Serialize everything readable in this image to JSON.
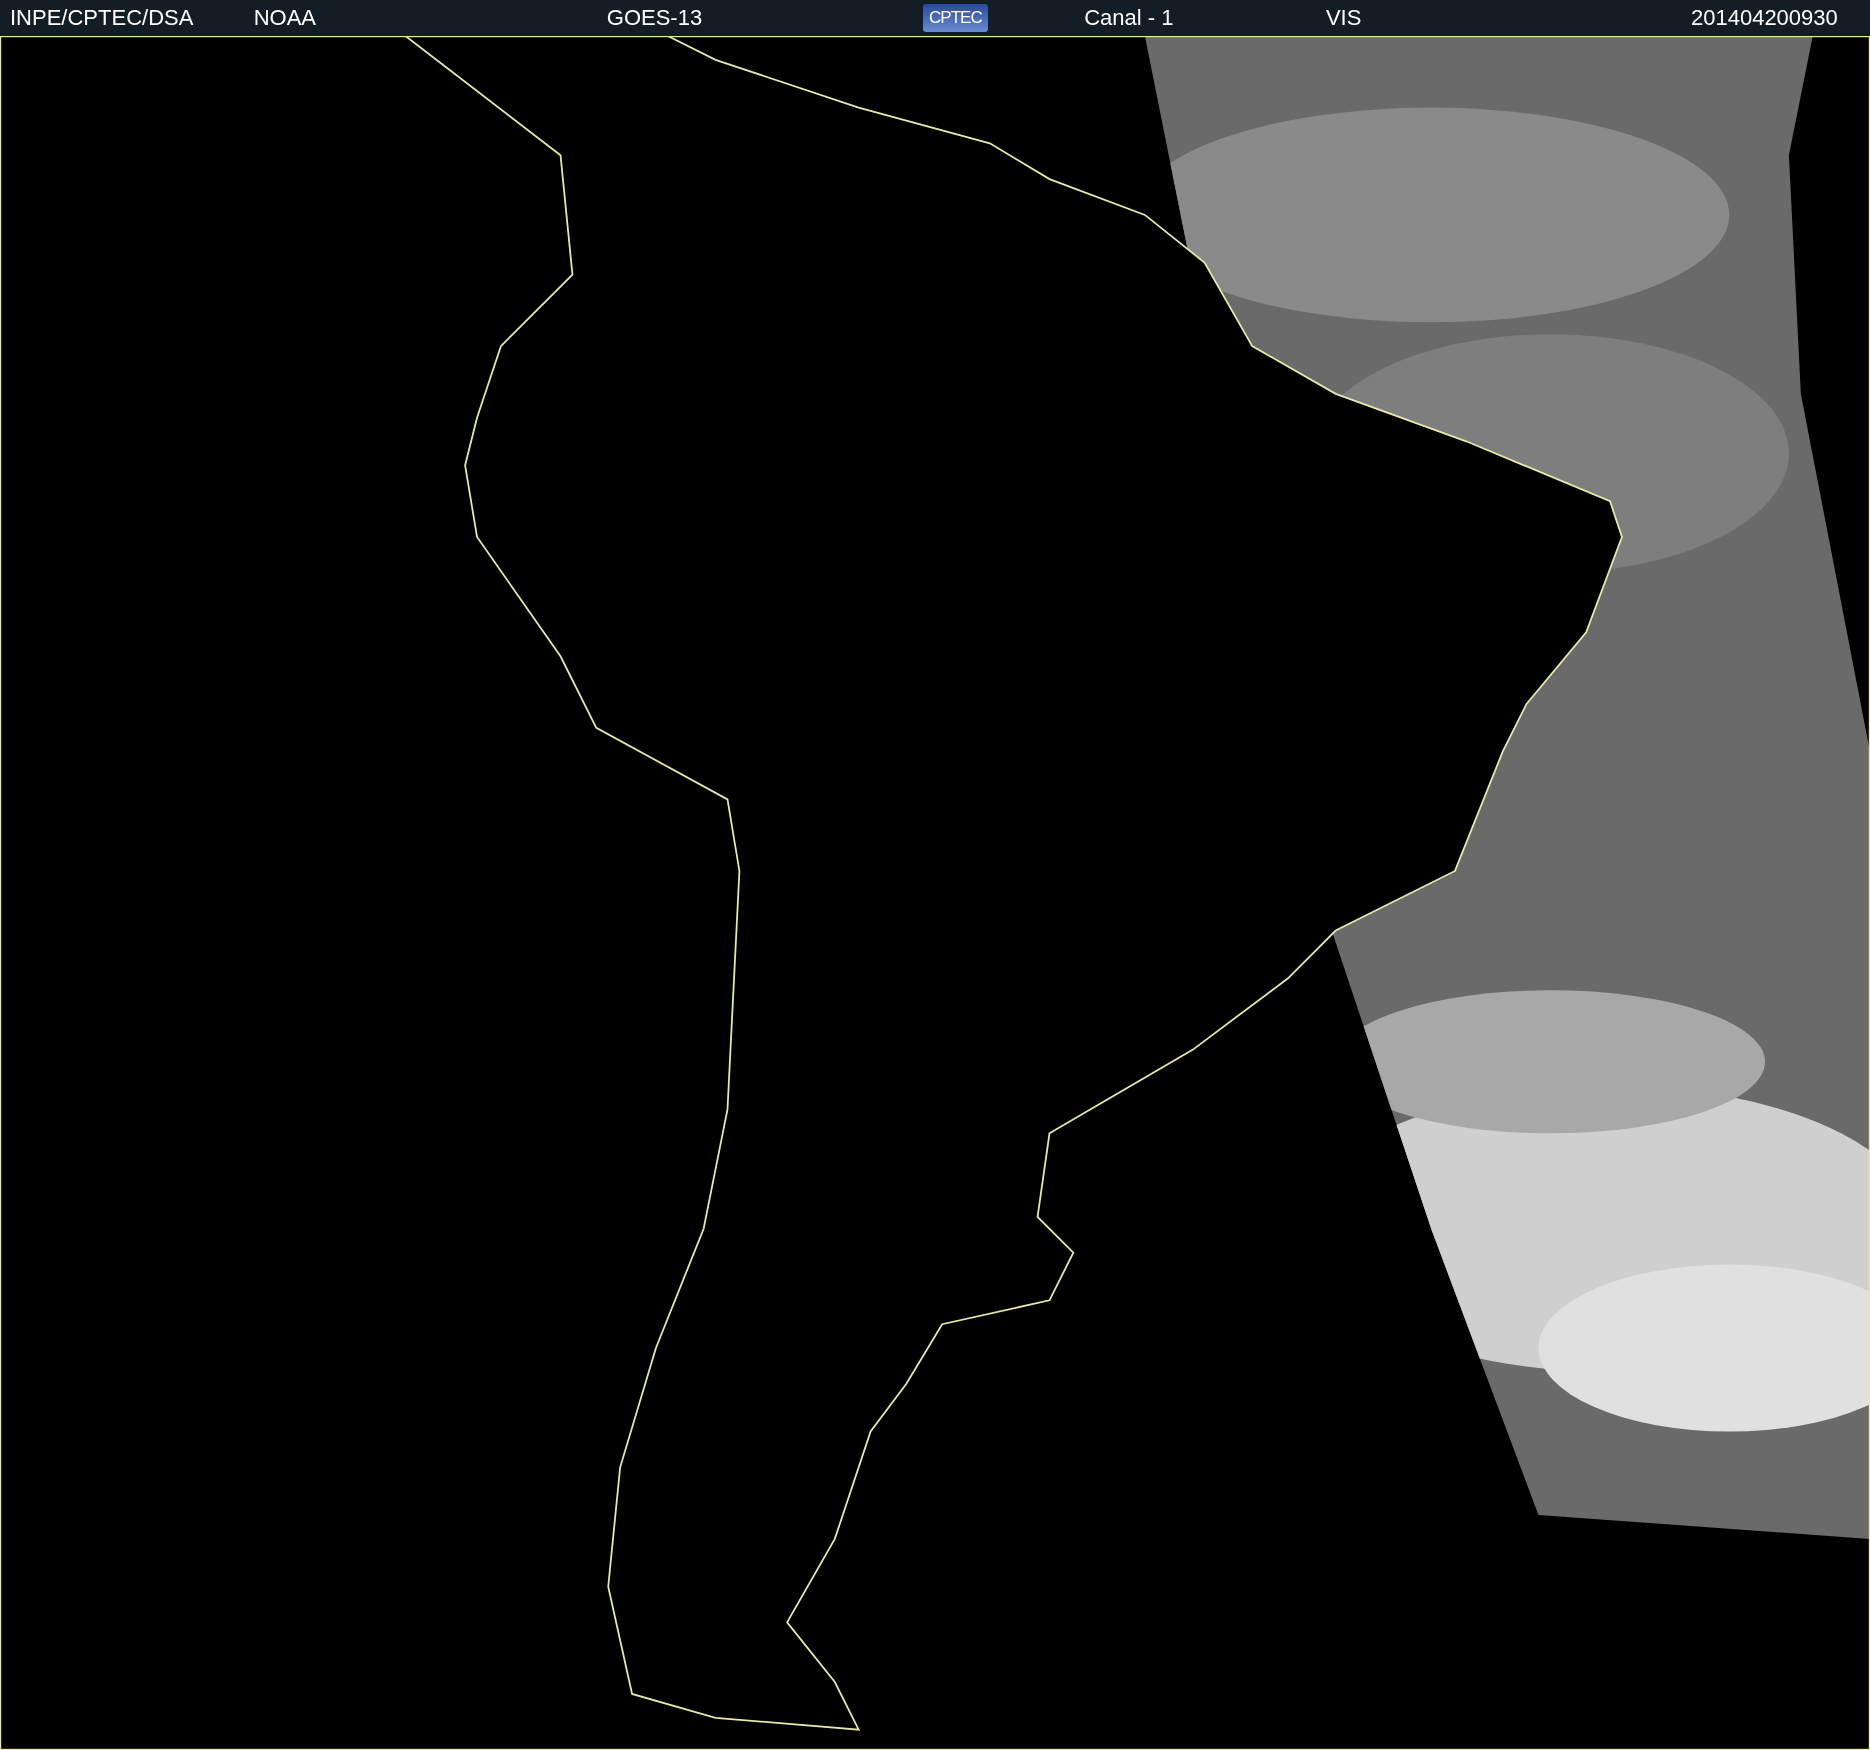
{
  "header": {
    "items": [
      {
        "kind": "text",
        "text": "INPE/CPTEC/DSA"
      },
      {
        "kind": "text",
        "text": "NOAA"
      },
      {
        "kind": "text",
        "text": "GOES-13"
      },
      {
        "kind": "logo",
        "text": "CPTEC"
      },
      {
        "kind": "text",
        "text": "Canal - 1"
      },
      {
        "kind": "text",
        "text": "VIS"
      },
      {
        "kind": "text",
        "text": "201404200930"
      }
    ]
  }
}
